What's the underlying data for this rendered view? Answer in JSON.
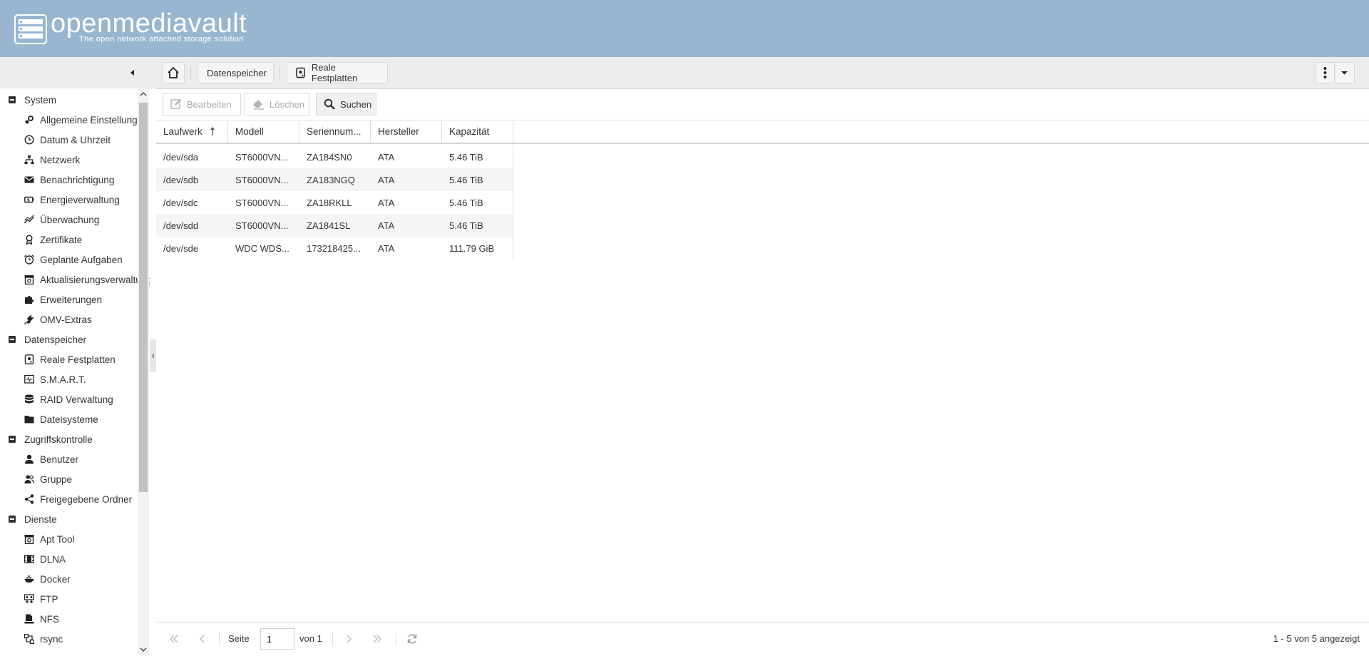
{
  "header": {
    "title": "openmediavault",
    "subtitle": "The open network attached storage solution"
  },
  "breadcrumb": {
    "items": [
      "Datenspeicher",
      "Reale Festplatten"
    ]
  },
  "sidebar": {
    "groups": [
      {
        "label": "System",
        "items": [
          {
            "label": "Allgemeine Einstellungen",
            "icon": "gears-icon"
          },
          {
            "label": "Datum & Uhrzeit",
            "icon": "clock-icon"
          },
          {
            "label": "Netzwerk",
            "icon": "network-icon"
          },
          {
            "label": "Benachrichtigung",
            "icon": "envelope-icon"
          },
          {
            "label": "Energieverwaltung",
            "icon": "battery-icon"
          },
          {
            "label": "Überwachung",
            "icon": "chart-line-icon"
          },
          {
            "label": "Zertifikate",
            "icon": "certificate-icon"
          },
          {
            "label": "Geplante Aufgaben",
            "icon": "alarm-clock-icon"
          },
          {
            "label": "Aktualisierungsverwaltung",
            "icon": "package-update-icon"
          },
          {
            "label": "Erweiterungen",
            "icon": "puzzle-icon"
          },
          {
            "label": "OMV-Extras",
            "icon": "plug-icon"
          }
        ]
      },
      {
        "label": "Datenspeicher",
        "items": [
          {
            "label": "Reale Festplatten",
            "icon": "harddisk-icon"
          },
          {
            "label": "S.M.A.R.T.",
            "icon": "monitor-icon"
          },
          {
            "label": "RAID Verwaltung",
            "icon": "database-icon"
          },
          {
            "label": "Dateisysteme",
            "icon": "folder-icon"
          }
        ]
      },
      {
        "label": "Zugriffskontrolle",
        "items": [
          {
            "label": "Benutzer",
            "icon": "user-icon"
          },
          {
            "label": "Gruppe",
            "icon": "group-icon"
          },
          {
            "label": "Freigegebene Ordner",
            "icon": "share-icon"
          }
        ]
      },
      {
        "label": "Dienste",
        "items": [
          {
            "label": "Apt Tool",
            "icon": "package-icon"
          },
          {
            "label": "DLNA",
            "icon": "film-icon"
          },
          {
            "label": "Docker",
            "icon": "docker-icon"
          },
          {
            "label": "FTP",
            "icon": "ftp-icon"
          },
          {
            "label": "NFS",
            "icon": "nfs-icon"
          },
          {
            "label": "rsync",
            "icon": "rsync-icon"
          }
        ]
      }
    ]
  },
  "toolbar": {
    "edit_label": "Bearbeiten",
    "delete_label": "Löschen",
    "search_label": "Suchen"
  },
  "table": {
    "columns": [
      "Laufwerk",
      "Modell",
      "Seriennum...",
      "Hersteller",
      "Kapazität"
    ],
    "rows": [
      [
        "/dev/sda",
        "ST6000VN...",
        "ZA184SN0",
        "ATA",
        "5.46 TiB"
      ],
      [
        "/dev/sdb",
        "ST6000VN...",
        "ZA183NGQ",
        "ATA",
        "5.46 TiB"
      ],
      [
        "/dev/sdc",
        "ST6000VN...",
        "ZA18RKLL",
        "ATA",
        "5.46 TiB"
      ],
      [
        "/dev/sdd",
        "ST6000VN...",
        "ZA1841SL",
        "ATA",
        "5.46 TiB"
      ],
      [
        "/dev/sde",
        "WDC WDS...",
        "173218425...",
        "ATA",
        "111.79 GiB"
      ]
    ]
  },
  "pager": {
    "page_label": "Seite",
    "page_value": "1",
    "of_label": "von 1",
    "status": "1 - 5 von 5 angezeigt"
  }
}
